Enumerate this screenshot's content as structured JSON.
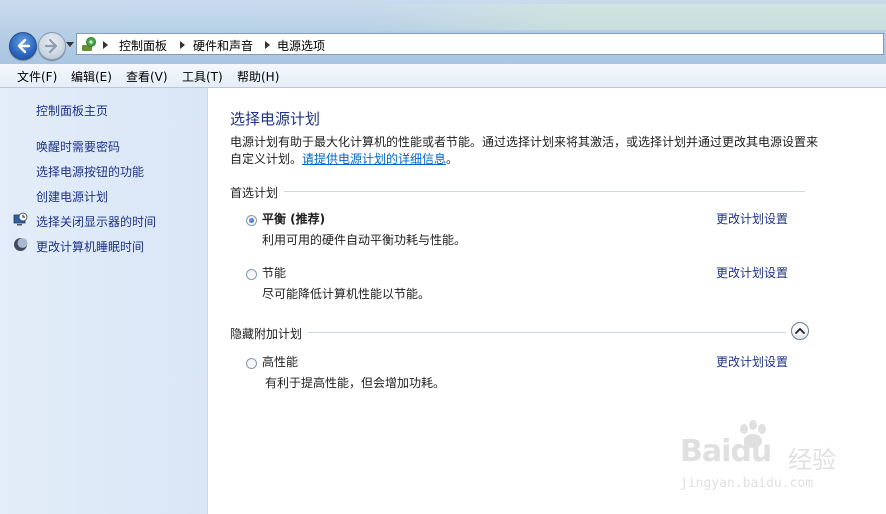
{
  "address": {
    "crumbs": [
      "控制面板",
      "硬件和声音",
      "电源选项"
    ]
  },
  "menu": {
    "items": [
      "文件(F)",
      "编辑(E)",
      "查看(V)",
      "工具(T)",
      "帮助(H)"
    ]
  },
  "sidebar": {
    "home": "控制面板主页",
    "links": [
      {
        "label": "唤醒时需要密码",
        "icon": ""
      },
      {
        "label": "选择电源按钮的功能",
        "icon": ""
      },
      {
        "label": "创建电源计划",
        "icon": ""
      },
      {
        "label": "选择关闭显示器的时间",
        "icon": "monitor-clock-icon"
      },
      {
        "label": "更改计算机睡眠时间",
        "icon": "moon-icon"
      }
    ]
  },
  "main": {
    "title": "选择电源计划",
    "description": "电源计划有助于最大化计算机的性能或者节能。通过选择计划来将其激活，或选择计划并通过更改其电源设置来自定义计划。",
    "details_link": "请提供电源计划的详细信息",
    "details_suffix": "。",
    "preferred_header": "首选计划",
    "hidden_header": "隐藏附加计划",
    "change_link": "更改计划设置",
    "plans": [
      {
        "name": "平衡 (推荐)",
        "desc": "利用可用的硬件自动平衡功耗与性能。",
        "selected": true
      },
      {
        "name": "节能",
        "desc": "尽可能降低计算机性能以节能。",
        "selected": false
      },
      {
        "name": "高性能",
        "desc": "有利于提高性能，但会增加功耗。",
        "selected": false
      }
    ]
  },
  "watermark": {
    "brand": "Baidu",
    "text": "经验",
    "url": "jingyan.baidu.com"
  }
}
